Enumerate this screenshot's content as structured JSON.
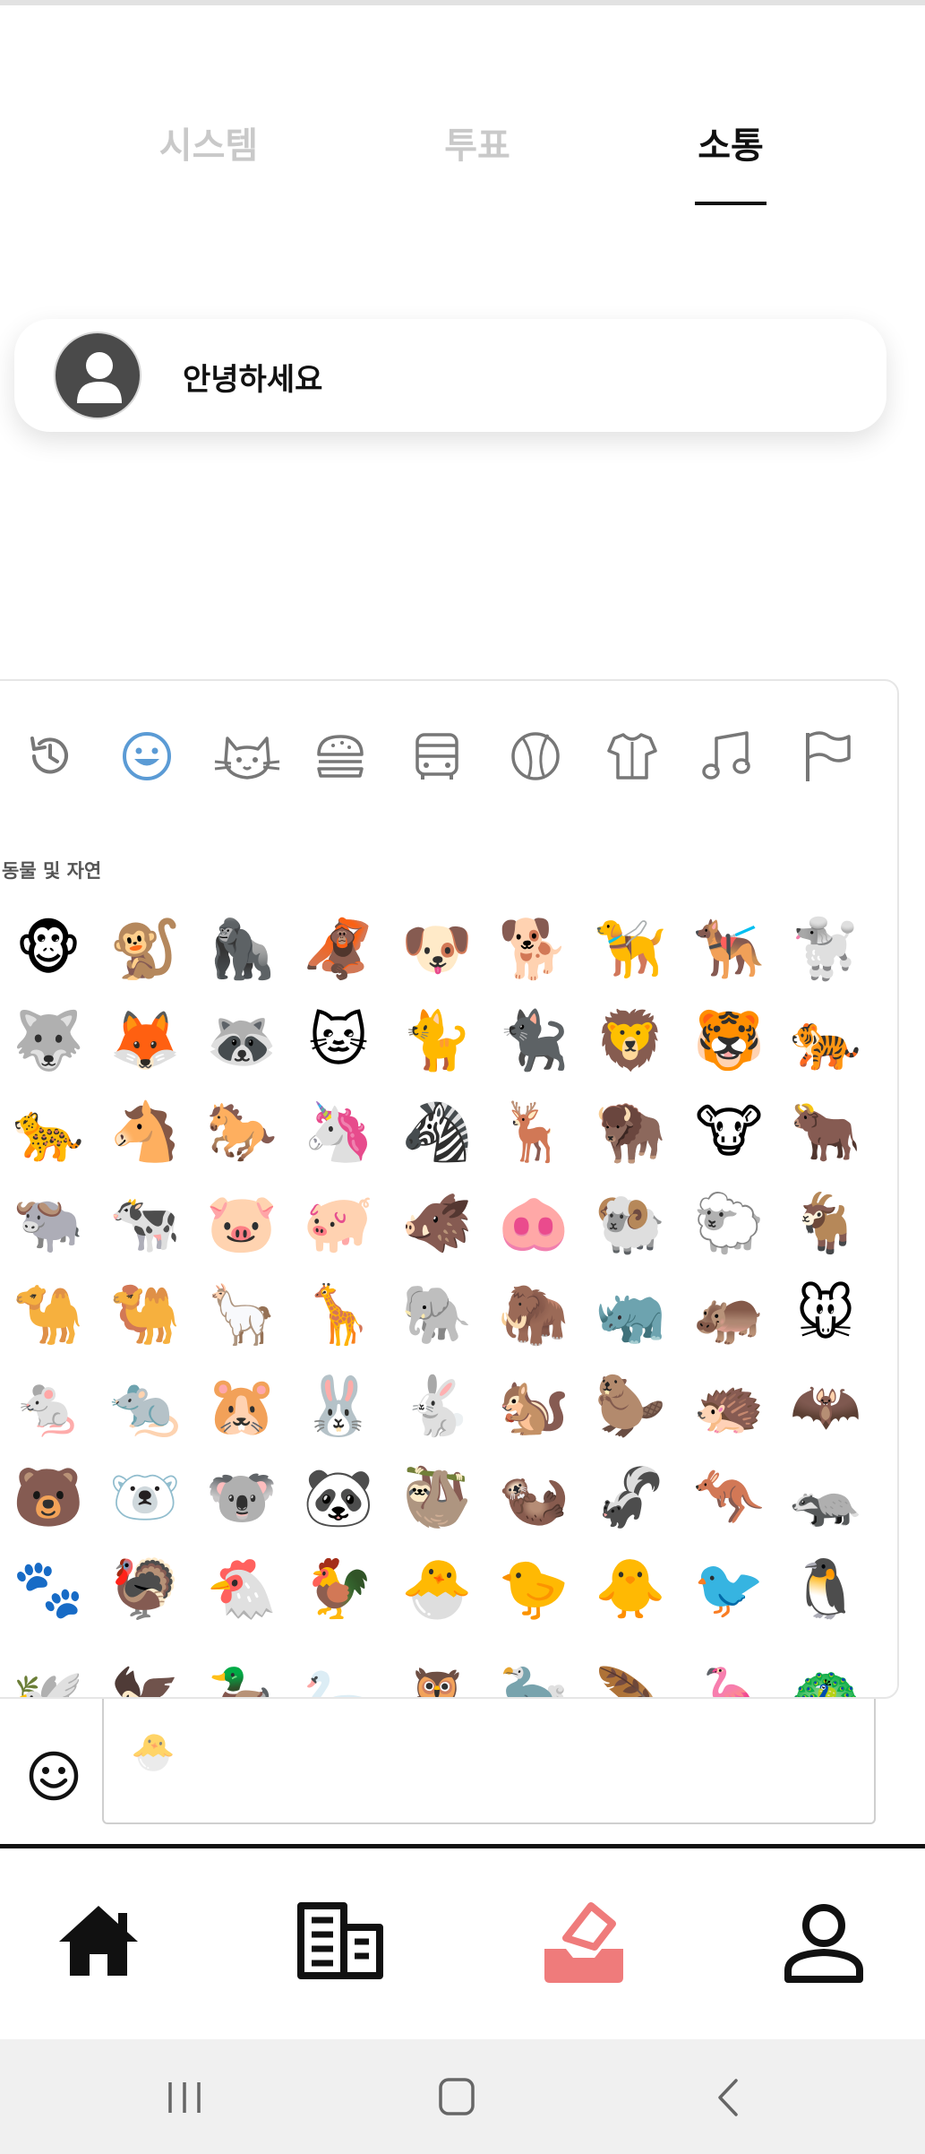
{
  "tabs": [
    {
      "label": "시스템",
      "active": false
    },
    {
      "label": "투표",
      "active": false
    },
    {
      "label": "소통",
      "active": true
    }
  ],
  "message": {
    "text": "안녕하세요",
    "avatar_icon": "user-silhouette-icon"
  },
  "emoji_panel": {
    "categories": [
      "recent-icon",
      "smileys-icon",
      "animals-icon",
      "food-icon",
      "travel-icon",
      "activity-icon",
      "objects-icon",
      "symbols-icon",
      "flags-icon"
    ],
    "active_category": "smileys-icon",
    "section_title": "동물 및 자연",
    "emojis": [
      [
        "🐵",
        "🐒",
        "🦍",
        "🦧",
        "🐶",
        "🐕",
        "🦮",
        "🐕‍🦺",
        "🐩"
      ],
      [
        "🐺",
        "🦊",
        "🦝",
        "🐱",
        "🐈",
        "🐈‍⬛",
        "🦁",
        "🐯",
        "🐅"
      ],
      [
        "🐆",
        "🐴",
        "🐎",
        "🦄",
        "🦓",
        "🦌",
        "🦬",
        "🐮",
        "🐂"
      ],
      [
        "🐃",
        "🐄",
        "🐷",
        "🐖",
        "🐗",
        "🐽",
        "🐏",
        "🐑",
        "🐐"
      ],
      [
        "🐪",
        "🐫",
        "🦙",
        "🦒",
        "🐘",
        "🦣",
        "🦏",
        "🦛",
        "🐭"
      ],
      [
        "🐁",
        "🐀",
        "🐹",
        "🐰",
        "🐇",
        "🐿️",
        "🦫",
        "🦔",
        "🦇"
      ],
      [
        "🐻",
        "🐻‍❄️",
        "🐨",
        "🐼",
        "🦥",
        "🦦",
        "🦨",
        "🦘",
        "🦡"
      ],
      [
        "🐾",
        "🦃",
        "🐔",
        "🐓",
        "🐣",
        "🐤",
        "🐥",
        "🐦",
        "🐧"
      ],
      [
        "🕊️",
        "🦅",
        "🦆",
        "🦢",
        "🦉",
        "🦤",
        "🪶",
        "🦩",
        "🦚"
      ]
    ]
  },
  "input": {
    "emoji_button_icon": "smiley-icon",
    "value": "🐣"
  },
  "bottom_nav": [
    {
      "name": "home",
      "icon": "home-icon",
      "color": "#111111"
    },
    {
      "name": "board",
      "icon": "building-icon",
      "color": "#111111"
    },
    {
      "name": "vote",
      "icon": "ballot-box-icon",
      "color": "#ef7b7b"
    },
    {
      "name": "profile",
      "icon": "person-icon",
      "color": "#111111"
    }
  ],
  "system_nav": [
    "recents-icon",
    "home-button-icon",
    "back-icon"
  ]
}
